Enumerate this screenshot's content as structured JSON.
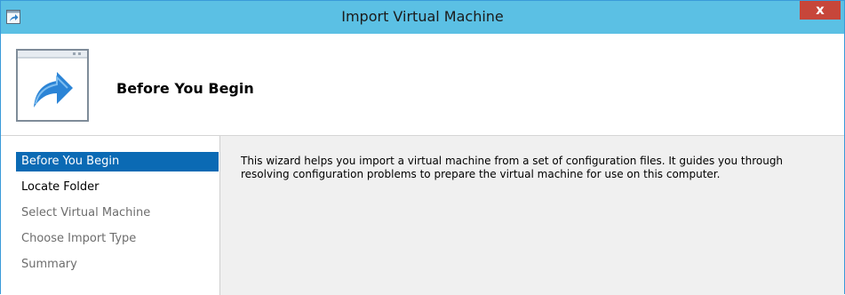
{
  "window": {
    "title": "Import Virtual Machine",
    "close_label": "x"
  },
  "header": {
    "title": "Before You Begin"
  },
  "nav": {
    "items": [
      {
        "label": "Before You Begin",
        "state": "selected"
      },
      {
        "label": "Locate Folder",
        "state": "active"
      },
      {
        "label": "Select Virtual Machine",
        "state": "disabled"
      },
      {
        "label": "Choose Import Type",
        "state": "disabled"
      },
      {
        "label": "Summary",
        "state": "disabled"
      }
    ]
  },
  "content": {
    "description": "This wizard helps you import a virtual machine from a set of configuration files. It guides you through resolving configuration problems to prepare the virtual machine for use on this computer."
  },
  "colors": {
    "titlebar": "#5bc0e4",
    "selected": "#0b6ab4",
    "close": "#c7463a"
  },
  "icons": {
    "window": "import-arrow-icon",
    "header": "import-wizard-icon"
  }
}
